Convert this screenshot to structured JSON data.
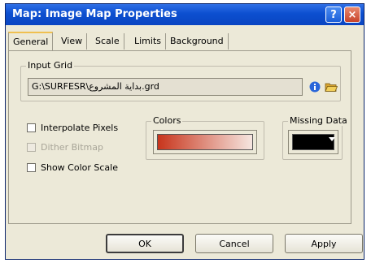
{
  "window": {
    "title": "Map: Image Map Properties",
    "help_glyph": "?",
    "close_glyph": "×"
  },
  "tabs": [
    {
      "label": "General",
      "active": true
    },
    {
      "label": "View",
      "active": false
    },
    {
      "label": "Scale",
      "active": false
    },
    {
      "label": "Limits",
      "active": false
    },
    {
      "label": "Background",
      "active": false
    }
  ],
  "input_grid": {
    "group_label": "Input Grid",
    "path": "G:\\SURFESR\\بداية المشروع.grd",
    "info_icon": "info-icon",
    "browse_icon": "open-folder-icon"
  },
  "options": {
    "interpolate_pixels": {
      "label": "Interpolate Pixels",
      "checked": false,
      "enabled": true
    },
    "dither_bitmap": {
      "label": "Dither Bitmap",
      "checked": false,
      "enabled": false
    },
    "show_color_scale": {
      "label": "Show Color Scale",
      "checked": false,
      "enabled": true
    }
  },
  "colors": {
    "group_label": "Colors",
    "gradient_start": "#c8351c",
    "gradient_end": "#f6e6e0"
  },
  "missing_data": {
    "group_label": "Missing Data",
    "color": "#000000"
  },
  "buttons": {
    "ok": "OK",
    "cancel": "Cancel",
    "apply": "Apply"
  }
}
